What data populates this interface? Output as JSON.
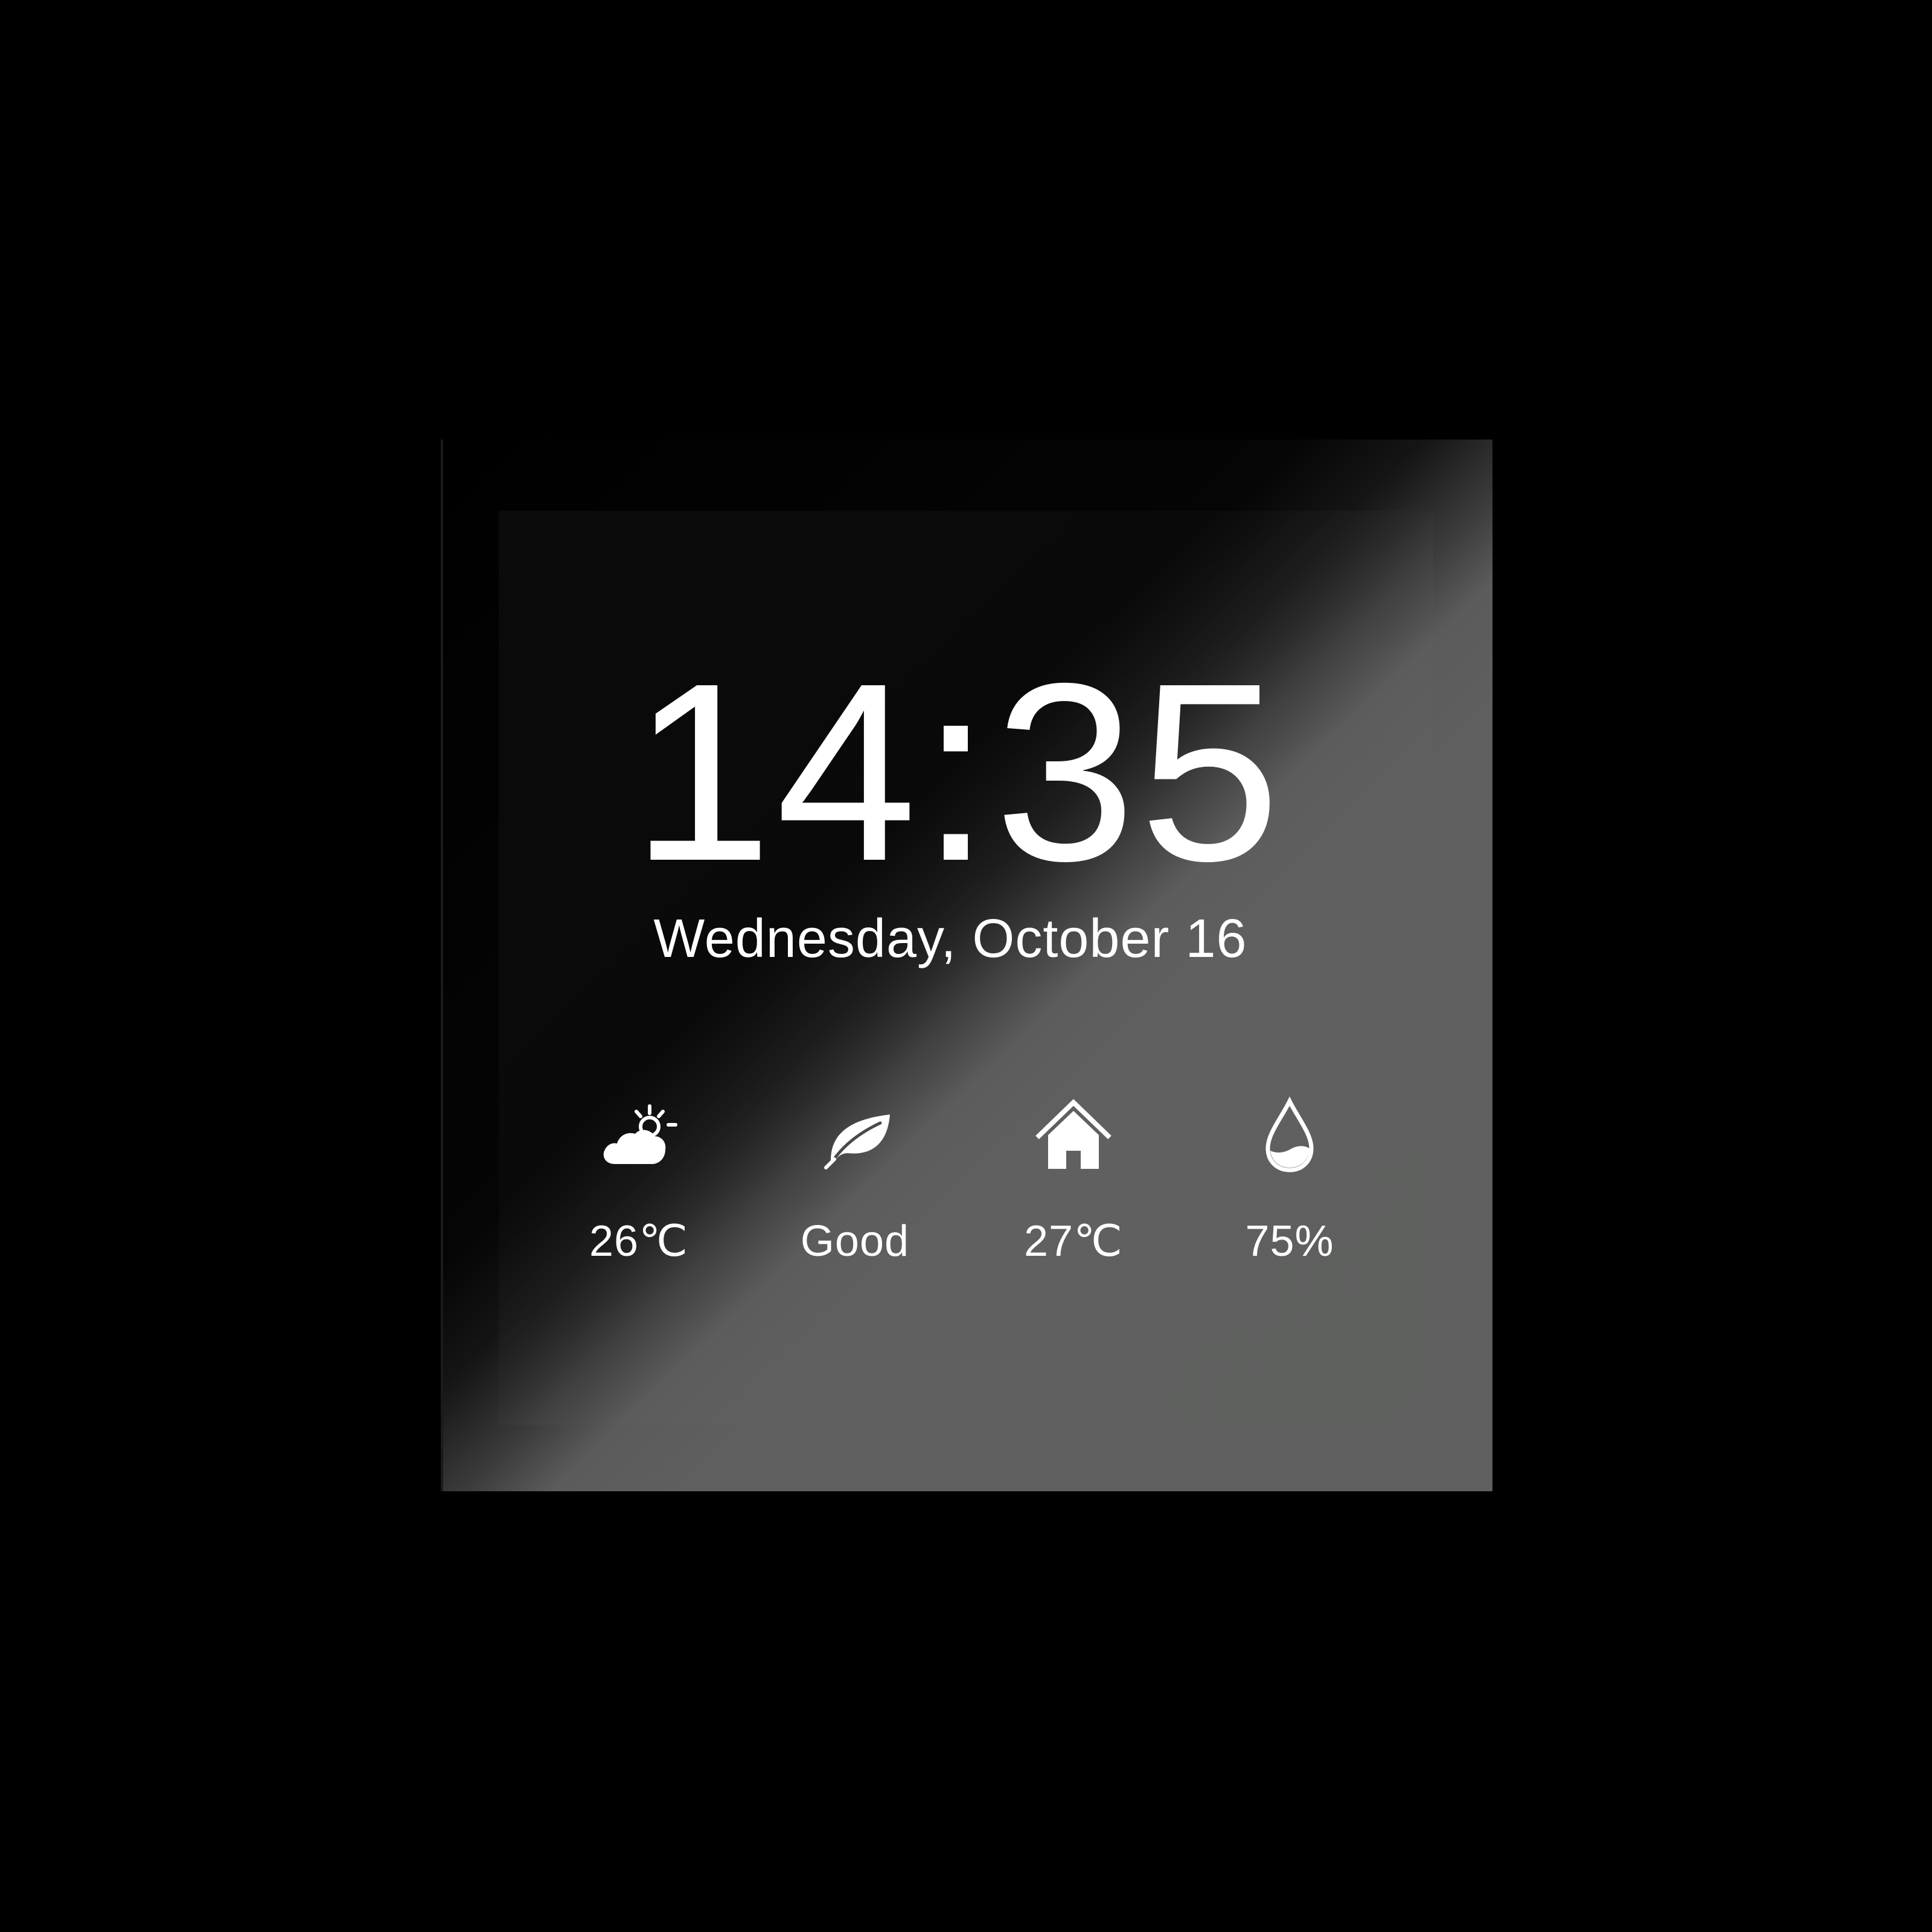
{
  "clock": {
    "time": "14:35",
    "date": "Wednesday, October 16"
  },
  "stats": {
    "weather": {
      "icon": "partly-cloudy-icon",
      "value": "26℃"
    },
    "air_quality": {
      "icon": "leaf-icon",
      "value": "Good"
    },
    "indoor_temp": {
      "icon": "home-icon",
      "value": "27℃"
    },
    "humidity": {
      "icon": "water-drop-icon",
      "value": "75%"
    }
  },
  "colors": {
    "background": "#000000",
    "text": "#ffffff",
    "panel_highlight": "#5e5f5e"
  }
}
